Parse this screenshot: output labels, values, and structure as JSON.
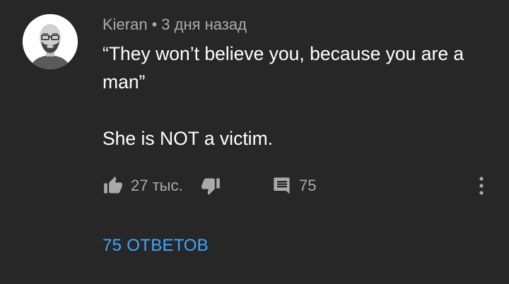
{
  "comment": {
    "author": "Kieran",
    "separator": "•",
    "time": "3 дня назад",
    "text_line1": "“They won’t believe you, because you are a man”",
    "text_line2": "She is NOT a victim.",
    "avatar_icon": "avatar-bald-man-with-glasses-beard"
  },
  "actions": {
    "like_icon": "thumb-up-icon",
    "like_count": "27 тыс.",
    "dislike_icon": "thumb-down-icon",
    "reply_icon": "comment-icon",
    "reply_count": "75",
    "more_icon": "vertical-dots-icon"
  },
  "replies": {
    "label": "75 ОТВЕТОВ",
    "color": "#3ea6ff"
  },
  "colors": {
    "background": "#272727",
    "primary_text": "#ffffff",
    "secondary_text": "#aaaaaa"
  }
}
